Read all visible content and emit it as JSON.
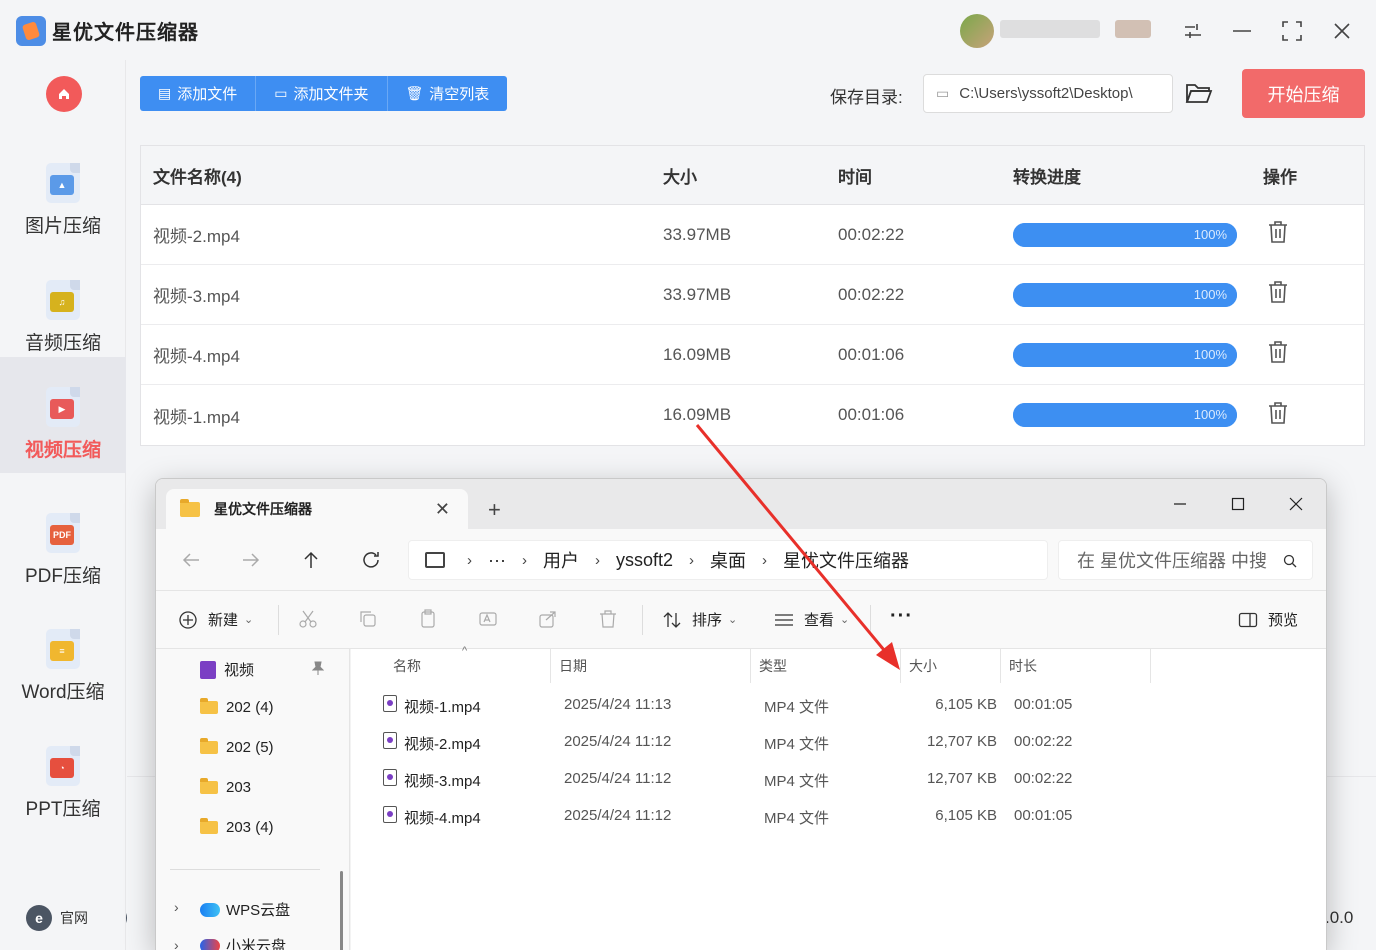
{
  "app": {
    "title": "星优文件压缩器",
    "version_text": ".0.0"
  },
  "sidebar": {
    "items": [
      {
        "label": "图片压缩",
        "icon": "image-icon"
      },
      {
        "label": "音频压缩",
        "icon": "music-icon"
      },
      {
        "label": "视频压缩",
        "icon": "video-icon",
        "active": true
      },
      {
        "label": "PDF压缩",
        "icon": "pdf-icon"
      },
      {
        "label": "Word压缩",
        "icon": "word-icon"
      },
      {
        "label": "PPT压缩",
        "icon": "ppt-icon"
      }
    ],
    "footer": {
      "website_label": "官网",
      "website_glyph": "e"
    }
  },
  "toolbar": {
    "add_file": "添加文件",
    "add_folder": "添加文件夹",
    "clear_list": "清空列表",
    "save_dir_label": "保存目录:",
    "save_dir_value": "C:\\Users\\yssoft2\\Desktop\\",
    "start_button": "开始压缩"
  },
  "file_table": {
    "headers": [
      "文件名称(4)",
      "大小",
      "时间",
      "转换进度",
      "操作"
    ],
    "rows": [
      {
        "name": "视频-2.mp4",
        "size": "33.97MB",
        "time": "00:02:22",
        "progress": "100%"
      },
      {
        "name": "视频-3.mp4",
        "size": "33.97MB",
        "time": "00:02:22",
        "progress": "100%"
      },
      {
        "name": "视频-4.mp4",
        "size": "16.09MB",
        "time": "00:01:06",
        "progress": "100%"
      },
      {
        "name": "视频-1.mp4",
        "size": "16.09MB",
        "time": "00:01:06",
        "progress": "100%"
      }
    ]
  },
  "explorer": {
    "tab_title": "星优文件压缩器",
    "breadcrumb": [
      "用户",
      "yssoft2",
      "桌面",
      "星优文件压缩器"
    ],
    "breadcrumb_more": "···",
    "search_placeholder": "在 星优文件压缩器 中搜",
    "toolbar": {
      "new_label": "新建",
      "sort_label": "排序",
      "view_label": "查看",
      "more_label": "···",
      "preview_label": "预览"
    },
    "tree": [
      {
        "label": "视频",
        "type": "video-library"
      },
      {
        "label": "202 (4)",
        "type": "folder"
      },
      {
        "label": "202 (5)",
        "type": "folder"
      },
      {
        "label": "203",
        "type": "folder"
      },
      {
        "label": "203 (4)",
        "type": "folder"
      },
      {
        "label": "WPS云盘",
        "type": "cloud"
      },
      {
        "label": "小米云盘",
        "type": "cloud"
      }
    ],
    "columns": [
      "名称",
      "日期",
      "类型",
      "大小",
      "时长"
    ],
    "files": [
      {
        "name": "视频-1.mp4",
        "date": "2025/4/24 11:13",
        "type": "MP4 文件",
        "size": "6,105 KB",
        "duration": "00:01:05"
      },
      {
        "name": "视频-2.mp4",
        "date": "2025/4/24 11:12",
        "type": "MP4 文件",
        "size": "12,707 KB",
        "duration": "00:02:22"
      },
      {
        "name": "视频-3.mp4",
        "date": "2025/4/24 11:12",
        "type": "MP4 文件",
        "size": "12,707 KB",
        "duration": "00:02:22"
      },
      {
        "name": "视频-4.mp4",
        "date": "2025/4/24 11:12",
        "type": "MP4 文件",
        "size": "6,105 KB",
        "duration": "00:01:05"
      }
    ]
  },
  "colors": {
    "accent_blue": "#3e8ef2",
    "accent_red": "#f26a6a",
    "arrow_red": "#e8302a"
  }
}
